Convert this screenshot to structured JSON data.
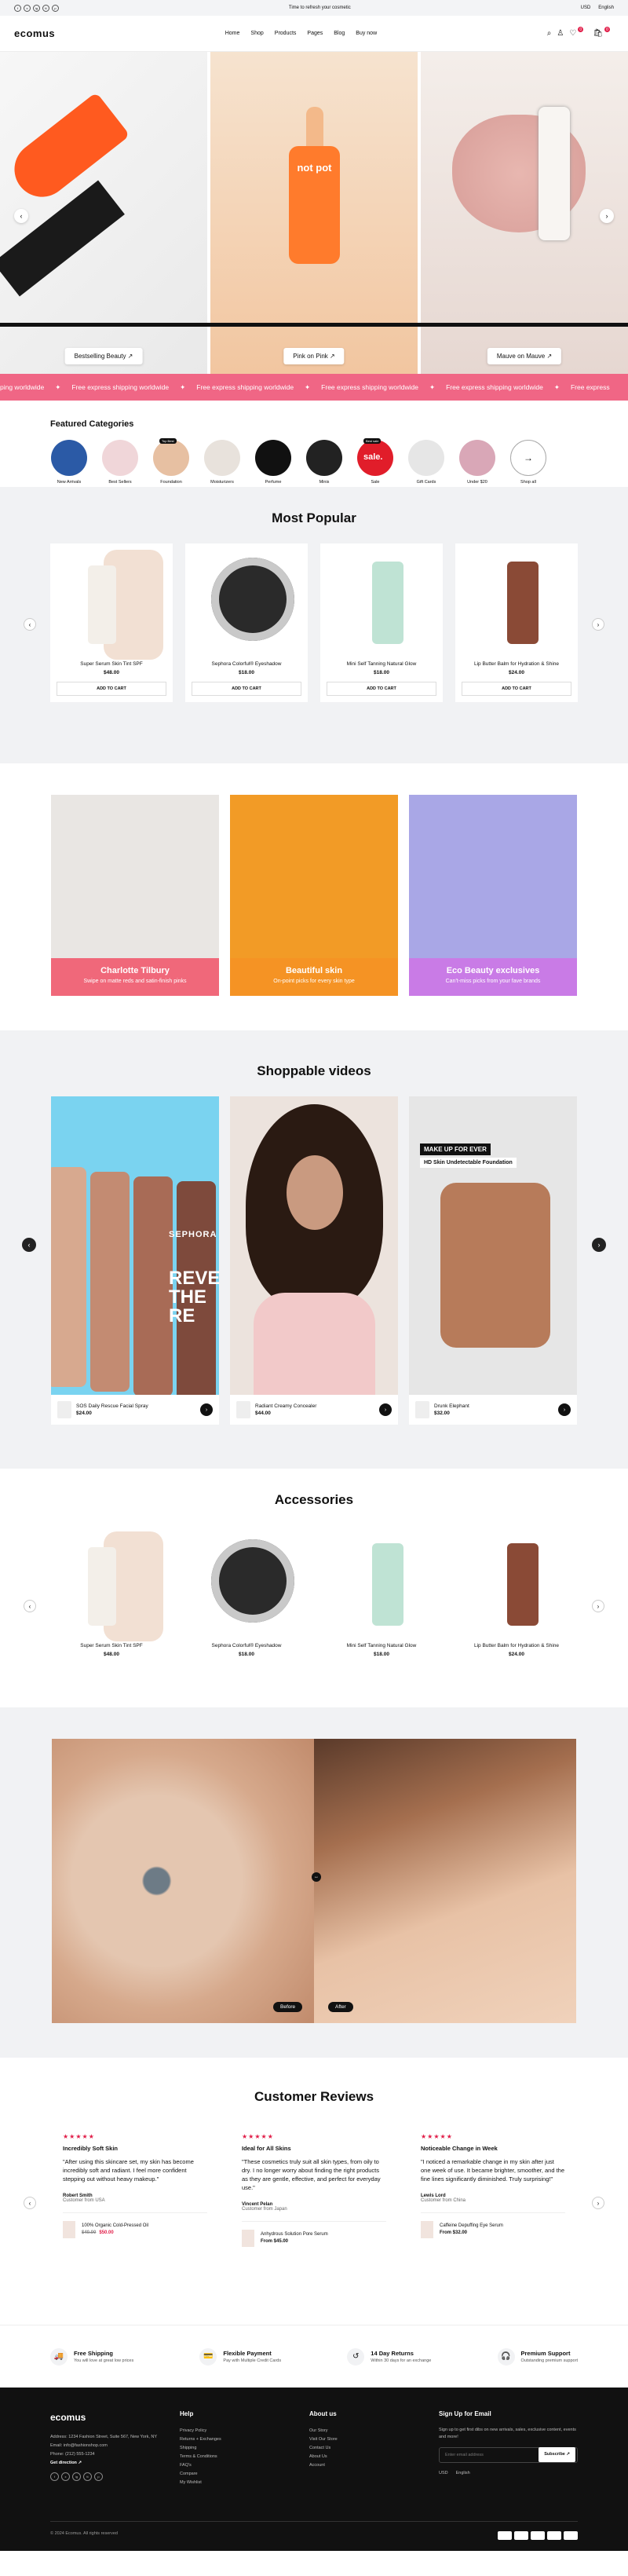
{
  "topbar": {
    "promo": "Time to refresh your cosmetic",
    "currency": "USD",
    "language": "English",
    "socials": [
      "f",
      "x",
      "ig",
      "tt",
      "p"
    ]
  },
  "header": {
    "logo": "ecomus",
    "nav": [
      "Home",
      "Shop",
      "Products",
      "Pages",
      "Blog",
      "Buy now"
    ],
    "wishlist_count": "0",
    "cart_count": "0"
  },
  "hero": {
    "slides": [
      {
        "button": "Bestselling Beauty ↗"
      },
      {
        "button": "Pink on Pink ↗",
        "bottle_text": "not pot"
      },
      {
        "button": "Mauve on Mauve ↗"
      }
    ]
  },
  "marquee": {
    "text": "Free express shipping worldwide",
    "items": [
      "ping worldwide",
      "Free express shipping worldwide",
      "Free express shipping worldwide",
      "Free express shipping worldwide",
      "Free express shipping worldwide",
      "Free express"
    ]
  },
  "categories": {
    "title": "Featured Categories",
    "items": [
      {
        "label": "New Arrivals",
        "color": "#2b5aa6"
      },
      {
        "label": "Best Sellers",
        "color": "#f0d6d9"
      },
      {
        "label": "Foundation",
        "color": "#e7c0a2",
        "tag": "Top Best"
      },
      {
        "label": "Moisturizers",
        "color": "#e8e2dc"
      },
      {
        "label": "Perfume",
        "color": "#111111"
      },
      {
        "label": "Minis",
        "color": "#222222"
      },
      {
        "label": "Sale",
        "color": "#e11d2a",
        "tag": "Best sale",
        "inner": "sale."
      },
      {
        "label": "Gift Cards",
        "color": "#e6e6e6"
      },
      {
        "label": "Under $20",
        "color": "#d9a7b7"
      },
      {
        "label": "Shop all",
        "color": "#ffffff"
      }
    ]
  },
  "popular": {
    "title": "Most Popular",
    "cart_label": "ADD TO CART",
    "products": [
      {
        "name": "Super Serum Skin Tint SPF",
        "price": "$48.00",
        "color": "#d9a27a"
      },
      {
        "name": "Sephora Colorful® Eyeshadow",
        "price": "$18.00",
        "color": "#2a2a2a"
      },
      {
        "name": "Mini Self Tanning Natural Glow",
        "price": "$18.00",
        "color": "#bfe3d4"
      },
      {
        "name": "Lip Butter Balm for Hydration & Shine",
        "price": "$24.00",
        "color": "#8a4a36"
      }
    ]
  },
  "promos": [
    {
      "title": "Charlotte Tilbury",
      "sub": "Swipe on matte reds and satin-finish pinks",
      "color": "#f0687a",
      "bg": "#e9e6e3"
    },
    {
      "title": "Beautiful skin",
      "sub": "On-point picks for every skin type",
      "color": "#f59324",
      "bg": "#f29b26"
    },
    {
      "title": "Eco Beauty exclusives",
      "sub": "Can't-miss picks from your fave brands",
      "color": "#c97be6",
      "bg": "#a9a7e6"
    }
  ],
  "videos": {
    "title": "Shoppable videos",
    "overlay_title": "MAKE UP FOR EVER",
    "overlay_sub": "HD Skin Undetectable Foundation",
    "brand": "SEPHORA",
    "brand_text": "REVEAL THE RE",
    "items": [
      {
        "name": "SOS Daily Rescue Facial Spray",
        "price": "$24.00",
        "bg": "#7ad3f0"
      },
      {
        "name": "Radiant Creamy Concealer",
        "price": "$44.00",
        "bg": "#ece3dd"
      },
      {
        "name": "Drunk Elephant",
        "price": "$32.00",
        "bg": "#e6e6e6"
      }
    ]
  },
  "accessories": {
    "title": "Accessories",
    "products": [
      {
        "name": "Super Serum Skin Tint SPF",
        "price": "$48.00",
        "color": "#d9a27a"
      },
      {
        "name": "Sephora Colorful® Eyeshadow",
        "price": "$18.00",
        "color": "#2a2a2a"
      },
      {
        "name": "Mini Self Tanning Natural Glow",
        "price": "$18.00",
        "color": "#bfe3d4"
      },
      {
        "name": "Lip Butter Balm for Hydration & Shine",
        "price": "$24.00",
        "color": "#8a4a36"
      }
    ]
  },
  "beforeafter": {
    "before": "Before",
    "after": "After"
  },
  "reviews": {
    "title": "Customer Reviews",
    "items": [
      {
        "title": "Incredibly Soft Skin",
        "text": "\"After using this skincare set, my skin has become incredibly soft and radiant. I feel more confident stepping out without heavy makeup.\"",
        "name": "Robert Smith",
        "from": "Customer from USA",
        "product": "100% Organic Cold-Pressed Oil",
        "old_price": "$40.00",
        "price": "$50.00"
      },
      {
        "title": "Ideal for All Skins",
        "text": "\"These cosmetics truly suit all skin types, from oily to dry. I no longer worry about finding the right products as they are gentle, effective, and perfect for everyday use.\"",
        "name": "Vincent Pelan",
        "from": "Customer from Japan",
        "product": "Anhydrous Solution Pore Serum",
        "price": "From $45.00"
      },
      {
        "title": "Noticeable Change in Week",
        "text": "\"I noticed a remarkable change in my skin after just one week of use. It became brighter, smoother, and the fine lines significantly diminished. Truly surprising!\"",
        "name": "Lewis Lord",
        "from": "Customer from China",
        "product": "Caffeine Depuffing Eye Serum",
        "price": "From $32.00"
      }
    ]
  },
  "features": [
    {
      "title": "Free Shipping",
      "sub": "You will love at great low prices",
      "icon": "🚚"
    },
    {
      "title": "Flexible Payment",
      "sub": "Pay with Multiple Credit Cards",
      "icon": "💳"
    },
    {
      "title": "14 Day Returns",
      "sub": "Within 30 days for an exchange",
      "icon": "↺"
    },
    {
      "title": "Premium Support",
      "sub": "Outstanding premium support",
      "icon": "🎧"
    }
  ],
  "footer": {
    "logo": "ecomus",
    "address": "Address: 1234 Fashion Street, Suite 567, New York, NY",
    "email": "Email: info@fashionshop.com",
    "phone": "Phone: (212) 555-1234",
    "directions": "Get direction ↗",
    "help_title": "Help",
    "help": [
      "Privacy Policy",
      "Returns + Exchanges",
      "Shipping",
      "Terms & Conditions",
      "FAQ's",
      "Compare",
      "My Wishlist"
    ],
    "about_title": "About us",
    "about": [
      "Our Story",
      "Visit Our Store",
      "Contact Us",
      "About Us",
      "Account"
    ],
    "signup_title": "Sign Up for Email",
    "signup_text": "Sign up to get first dibs on new arrivals, sales, exclusive content, events and more!",
    "email_placeholder": "Enter email address",
    "subscribe": "Subscribe ↗",
    "currency": "USD",
    "language": "English",
    "copyright": "© 2024 Ecomus. All rights reserved"
  }
}
